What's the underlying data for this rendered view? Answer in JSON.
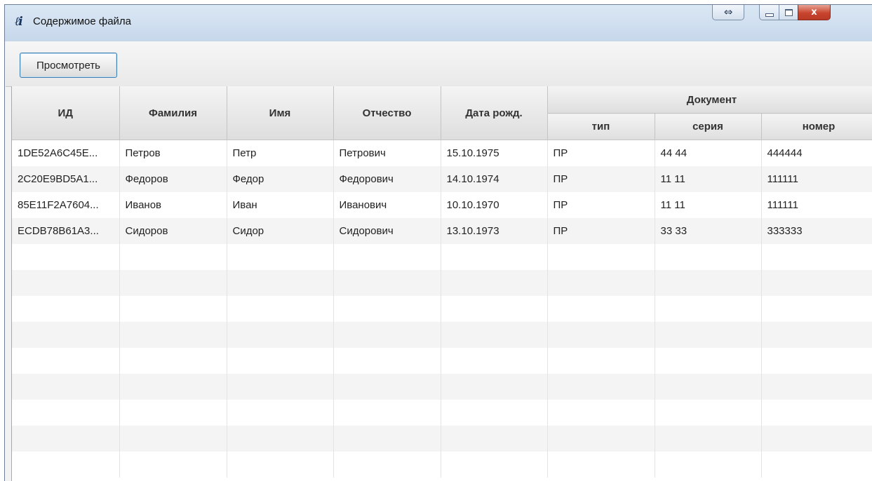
{
  "window": {
    "title": "Содержимое файла",
    "close_label": "x",
    "resize_label": "⇔"
  },
  "toolbar": {
    "view_label": "Просмотреть"
  },
  "table": {
    "headers": {
      "id": "ИД",
      "last_name": "Фамилия",
      "first_name": "Имя",
      "patronymic": "Отчество",
      "birth_date": "Дата рожд.",
      "document": "Документ",
      "doc_type": "тип",
      "doc_series": "серия",
      "doc_number": "номер"
    },
    "rows": [
      [
        "1DE52A6C45E...",
        "Петров",
        "Петр",
        "Петрович",
        "15.10.1975",
        "ПР",
        "44 44",
        "444444"
      ],
      [
        "2C20E9BD5A1...",
        "Федоров",
        "Федор",
        "Федорович",
        "14.10.1974",
        "ПР",
        "11 11",
        "111111"
      ],
      [
        "85E11F2A7604...",
        "Иванов",
        "Иван",
        "Иванович",
        "10.10.1970",
        "ПР",
        "11 11",
        "111111"
      ],
      [
        "ECDB78B61A3...",
        "Сидоров",
        "Сидор",
        "Сидорович",
        "13.10.1973",
        "ПР",
        "33 33",
        "333333"
      ]
    ],
    "empty_rows": 9
  }
}
